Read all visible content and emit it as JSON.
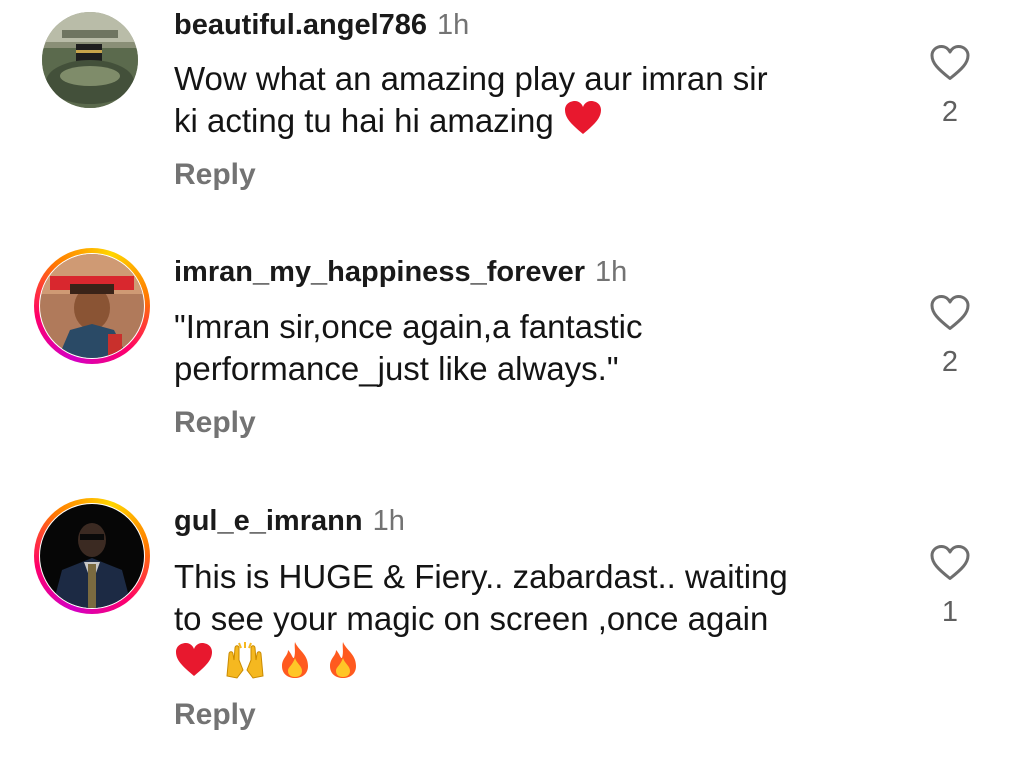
{
  "comments": [
    {
      "username": "beautiful.angel786",
      "time": "1h",
      "line1": "Wow what an amazing play aur  imran sir",
      "line2": "ki acting tu hai hi amazing",
      "reply_label": "Reply",
      "likes": "2",
      "emoji": [
        "red-heart"
      ]
    },
    {
      "username": "imran_my_happiness_forever",
      "time": "1h",
      "line1": "\"Imran sir,once again,a fantastic",
      "line2": "performance_just like always.\"",
      "reply_label": "Reply",
      "likes": "2"
    },
    {
      "username": "gul_e_imrann",
      "time": "1h",
      "line1": "This is HUGE & Fiery.. zabardast.. waiting",
      "line2": "to see your magic on screen ,once again",
      "reply_label": "Reply",
      "likes": "1",
      "emoji": [
        "red-heart",
        "raising-hands",
        "fire",
        "fire"
      ]
    }
  ],
  "icons": {
    "like": "heart-outline-icon"
  },
  "colors": {
    "text": "#141414",
    "secondary": "#737373",
    "story_ring_start": "#d300c5",
    "story_ring_end": "#ffd600"
  }
}
